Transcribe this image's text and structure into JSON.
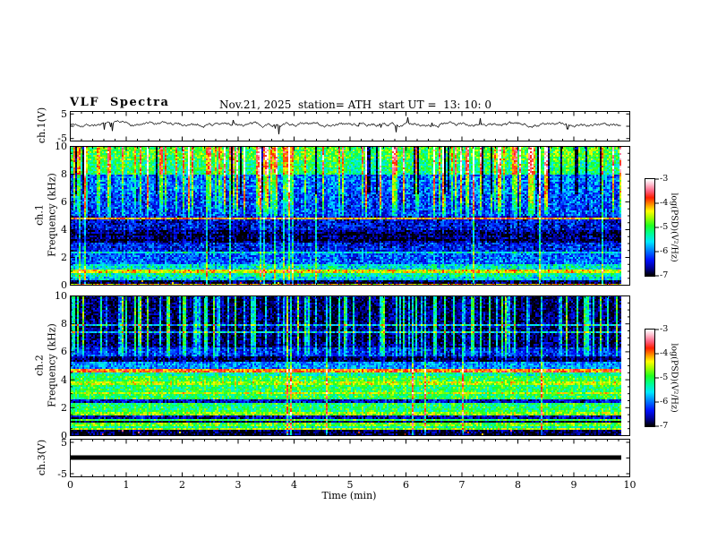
{
  "header": {
    "title": "VLF  Spectra",
    "date": "Nov.21, 2025",
    "station": "station= ATH",
    "start_ut": "start UT =  13: 10: 0"
  },
  "axes": {
    "time": {
      "label": "Time (min)",
      "min": 0,
      "max": 10,
      "major_ticks": [
        0,
        1,
        2,
        3,
        4,
        5,
        6,
        7,
        8,
        9,
        10
      ],
      "minor_step": 0.2
    },
    "frequency": {
      "ticks": [
        10,
        8,
        6,
        4,
        2,
        0
      ],
      "minor_step": 0.5,
      "min": 0,
      "max": 10
    },
    "voltage": {
      "ticks": [
        5,
        -5
      ],
      "min": -5,
      "max": 5
    }
  },
  "panels": {
    "ch1_wave": {
      "ylabel": "ch.1(V)"
    },
    "ch1_spec": {
      "ylabel_line1": "ch.1",
      "ylabel_line2": "Frequency (kHz)"
    },
    "ch2_spec": {
      "ylabel_line1": "ch.2",
      "ylabel_line2": "Frequency (kHz)"
    },
    "ch3_wave": {
      "ylabel": "ch.3(V)"
    }
  },
  "colorbar": {
    "label": "log(PSD)(V²/Hz)",
    "ticks": [
      -3,
      -4,
      -5,
      -6,
      -7
    ],
    "min": -7,
    "max": -3,
    "stops": [
      [
        0.0,
        "#000000"
      ],
      [
        0.07,
        "#000090"
      ],
      [
        0.16,
        "#0010ff"
      ],
      [
        0.26,
        "#0080ff"
      ],
      [
        0.35,
        "#00e8ff"
      ],
      [
        0.44,
        "#00ff90"
      ],
      [
        0.52,
        "#20ff20"
      ],
      [
        0.6,
        "#a0ff00"
      ],
      [
        0.67,
        "#ffff00"
      ],
      [
        0.74,
        "#ff9000"
      ],
      [
        0.81,
        "#ff2000"
      ],
      [
        0.88,
        "#ff6080"
      ],
      [
        0.95,
        "#ffc0d0"
      ],
      [
        1.0,
        "#ffffff"
      ]
    ]
  },
  "chart_data": [
    {
      "type": "line",
      "panel": "ch1_waveform",
      "ylabel": "ch.1(V)",
      "xlim": [
        0,
        10
      ],
      "ylim": [
        -5,
        5
      ],
      "data_frac": 0.985,
      "description": "Noisy black trace around +0.5 V with frequent downward spikes reaching -3 to -5 V",
      "gen": {
        "baseline": 0.55,
        "walk": 0.78,
        "step": 1.0,
        "spike_down_prob": 0.02,
        "spike_down_extra": 3.4,
        "spike_up_prob": 0.012,
        "spike_up_extra": 1.8
      }
    },
    {
      "type": "heatmap",
      "panel": "ch1_spectrogram",
      "xlim": [
        0,
        10
      ],
      "ylim": [
        0,
        10
      ],
      "zlim": [
        -7,
        -3
      ],
      "fmax": 10,
      "zmin": -7,
      "zmax": -3,
      "noise": 0.5,
      "data_frac": 0.985,
      "description": "VLF spectrogram ch.1: green 8-10 kHz, blue 4-8 kHz with green sferic streaks, red line ~4.8 kHz, dark 3-4 kHz, cyan/green bands below 2 kHz, black band at 0",
      "bands": [
        [
          9.0,
          10.01,
          -4.9
        ],
        [
          8.0,
          9.0,
          -5.15
        ],
        [
          6.5,
          8.0,
          -6.05
        ],
        [
          5.0,
          6.5,
          -6.2
        ],
        [
          4.0,
          5.0,
          -6.45
        ],
        [
          3.0,
          4.0,
          -6.75
        ],
        [
          2.4,
          3.0,
          -6.35
        ],
        [
          1.5,
          2.4,
          -6.1
        ],
        [
          1.05,
          1.5,
          -5.5
        ],
        [
          0.85,
          1.05,
          -4.35
        ],
        [
          0.55,
          0.85,
          -5.3
        ],
        [
          0.3,
          0.55,
          -5.6
        ],
        [
          0.12,
          0.3,
          -6.9
        ],
        [
          0.0,
          0.12,
          -4.2
        ]
      ],
      "hlines": [
        [
          4.8,
          0.06,
          -4.1
        ],
        [
          3.25,
          0.05,
          -7.0
        ],
        [
          3.6,
          0.05,
          -7.0
        ],
        [
          2.3,
          0.04,
          -5.5
        ],
        [
          2.75,
          0.04,
          -5.6
        ],
        [
          4.3,
          0.04,
          -5.6
        ],
        [
          5.5,
          0.04,
          -5.8
        ],
        [
          6.15,
          0.04,
          -5.7
        ],
        [
          7.0,
          0.04,
          -5.9
        ],
        [
          7.5,
          0.04,
          -5.9
        ],
        [
          0.95,
          0.04,
          -4.3
        ]
      ],
      "streaks": {
        "bright_prob": 0.26,
        "bright_boost": [
          0.8,
          2.2
        ],
        "bright_fmin": 4.5,
        "full_prob": 0.05,
        "dark_prob": 0.07,
        "dark_fmin": 6.5
      },
      "hot_dots": {
        "fmax": 0.3,
        "prob": 0.02,
        "value": -4.0
      }
    },
    {
      "type": "heatmap",
      "panel": "ch2_spectrogram",
      "xlim": [
        0,
        10
      ],
      "ylim": [
        0,
        10
      ],
      "zlim": [
        -7,
        -3
      ],
      "fmax": 10,
      "zmin": -7,
      "zmax": -3,
      "noise": 0.45,
      "data_frac": 0.985,
      "description": "VLF spectrogram ch.2: dark blue 6-10 kHz with cyan streaks, red/orange band ~4.5 kHz, green 1-4 kHz with yellow bands, black band at 0",
      "bands": [
        [
          6.3,
          10.01,
          -6.8
        ],
        [
          5.6,
          6.3,
          -6.3
        ],
        [
          5.3,
          5.6,
          -6.85
        ],
        [
          4.75,
          5.3,
          -5.9
        ],
        [
          4.45,
          4.75,
          -3.95
        ],
        [
          4.2,
          4.45,
          -5.3
        ],
        [
          3.8,
          4.2,
          -4.95
        ],
        [
          3.55,
          3.8,
          -4.55
        ],
        [
          2.6,
          3.55,
          -5.05
        ],
        [
          2.35,
          2.6,
          -6.5
        ],
        [
          1.7,
          2.35,
          -5.1
        ],
        [
          1.45,
          1.7,
          -4.65
        ],
        [
          1.2,
          1.45,
          -6.6
        ],
        [
          0.85,
          1.2,
          -5.0
        ],
        [
          0.6,
          0.85,
          -4.8
        ],
        [
          0.35,
          0.6,
          -5.3
        ],
        [
          0.0,
          0.35,
          -6.9
        ]
      ],
      "hlines": [
        [
          7.35,
          0.05,
          -5.7
        ],
        [
          7.9,
          0.05,
          -5.75
        ],
        [
          3.0,
          0.06,
          -4.5
        ],
        [
          0.95,
          0.04,
          -6.9
        ],
        [
          0.65,
          0.04,
          -6.9
        ],
        [
          0.45,
          0.05,
          -4.6
        ],
        [
          0.12,
          0.03,
          -5.2
        ]
      ],
      "streaks": {
        "bright_prob": 0.3,
        "bright_boost": [
          0.8,
          2.0
        ],
        "bright_fmin": 5.2,
        "full_prob": 0.015,
        "dark_prob": 0.0,
        "dark_fmin": 10
      },
      "hot_dots": {
        "fmax": 0.35,
        "prob": 0.008,
        "value": -3.9
      }
    },
    {
      "type": "line",
      "panel": "ch3_waveform",
      "ylabel": "ch.3(V)",
      "xlim": [
        0,
        10
      ],
      "ylim": [
        -5,
        5
      ],
      "value": 0,
      "data_frac": 0.985,
      "description": "Flat thick black line at 0 V (no signal)"
    }
  ]
}
